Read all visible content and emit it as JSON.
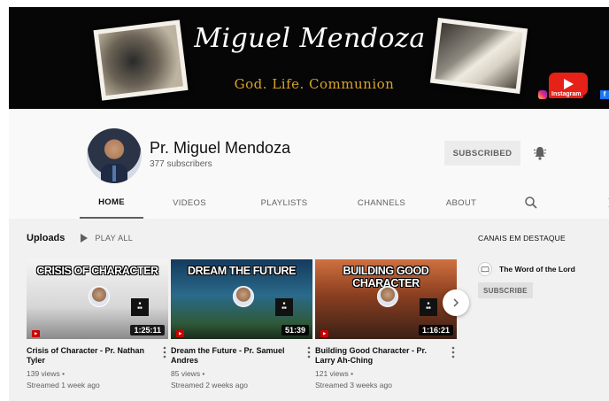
{
  "banner": {
    "title": "Miguel Mendoza",
    "subtitle": "God. Life. Communion",
    "instagram_label": "Instagram"
  },
  "channel": {
    "name": "Pr. Miguel Mendoza",
    "subscribers": "377 subscribers",
    "subscribed_label": "SUBSCRIBED"
  },
  "tabs": [
    {
      "label": "HOME",
      "active": true
    },
    {
      "label": "VIDEOS"
    },
    {
      "label": "PLAYLISTS"
    },
    {
      "label": "CHANNELS"
    },
    {
      "label": "ABOUT"
    }
  ],
  "uploads": {
    "title": "Uploads",
    "play_all": "PLAY ALL"
  },
  "videos": [
    {
      "thumb_title": "CRISIS OF CHARACTER",
      "duration": "1:25:11",
      "title": "Crisis of Character - Pr. Nathan Tyler",
      "views": "139 views •",
      "date": "Streamed 1 week ago",
      "thumb_colors": [
        "#f2f2f2",
        "#9a9a9a"
      ]
    },
    {
      "thumb_title": "DREAM THE FUTURE",
      "duration": "51:39",
      "title": "Dream the Future - Pr. Samuel Andres",
      "views": "85 views •",
      "date": "Streamed 2 weeks ago",
      "thumb_colors": [
        "#1c5a8a",
        "#3f7a5a"
      ]
    },
    {
      "thumb_title": "BUILDING GOOD CHARACTER",
      "duration": "1:16:21",
      "title": "Building Good Character - Pr. Larry Ah-Ching",
      "views": "121 views •",
      "date": "Streamed 3 weeks ago",
      "thumb_colors": [
        "#b55a2a",
        "#4a2a1a"
      ]
    }
  ],
  "featured": {
    "heading": "CANAIS EM DESTAQUE",
    "channel_name": "The Word of the Lord",
    "subscribe_label": "SUBSCRIBE"
  },
  "colors": {
    "accent_red": "#e62117",
    "banner_gold": "#d9a32c"
  }
}
